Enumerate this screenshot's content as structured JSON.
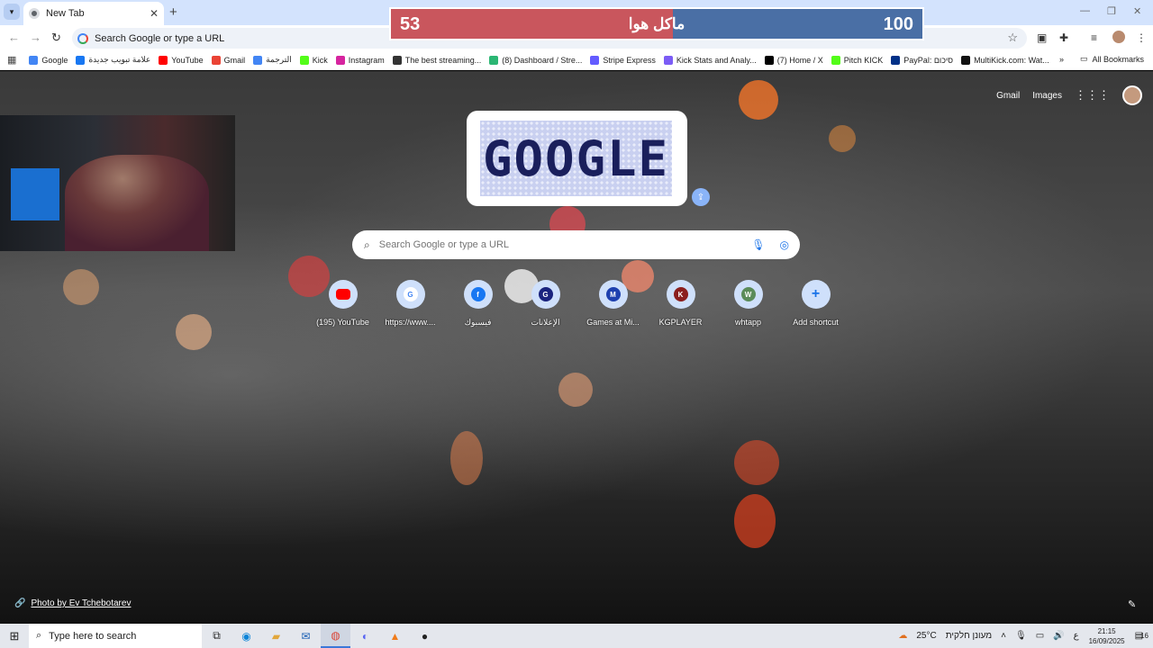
{
  "browser": {
    "tab_title": "New Tab",
    "omnibox_text": "Search Google or type a URL",
    "bookmarks": [
      {
        "label": "Google",
        "color": "#4285f4"
      },
      {
        "label": "علامة تبويب جديدة",
        "color": "#1877f2"
      },
      {
        "label": "YouTube",
        "color": "#ff0000"
      },
      {
        "label": "Gmail",
        "color": "#ea4335"
      },
      {
        "label": "الترجمة",
        "color": "#4285f4"
      },
      {
        "label": "Kick",
        "color": "#53fc18"
      },
      {
        "label": "Instagram",
        "color": "#d6249f"
      },
      {
        "label": "The best streaming...",
        "color": "#333333"
      },
      {
        "label": "(8) Dashboard / Stre...",
        "color": "#2bb673"
      },
      {
        "label": "Stripe Express",
        "color": "#635bff"
      },
      {
        "label": "Kick Stats and Analy...",
        "color": "#7b5cf5"
      },
      {
        "label": "(7) Home / X",
        "color": "#000000"
      },
      {
        "label": "Pitch KICK",
        "color": "#53fc18"
      },
      {
        "label": "PayPal: סיכום",
        "color": "#003087"
      },
      {
        "label": "MultiKick.com: Wat...",
        "color": "#111111"
      }
    ],
    "all_bookmarks_label": "All Bookmarks"
  },
  "ntp": {
    "gmail_link": "Gmail",
    "images_link": "Images",
    "doodle_text": "GOOGLE",
    "search_placeholder": "Search Google or type a URL",
    "shortcuts": [
      {
        "label": "(195) YouTube",
        "initial": "",
        "color": "#ff0000",
        "icon": "youtube-icon"
      },
      {
        "label": "https://www....",
        "initial": "G",
        "color": "#4285f4",
        "icon": "google-icon"
      },
      {
        "label": "فيسبوك",
        "initial": "f",
        "color": "#1877f2",
        "icon": "facebook-icon"
      },
      {
        "label": "الإعلانات",
        "initial": "G",
        "color": "#1a237e",
        "icon": "ads-icon"
      },
      {
        "label": "Games at Mi...",
        "initial": "M",
        "color": "#1e40af",
        "icon": "games-icon"
      },
      {
        "label": "KGPLAYER",
        "initial": "K",
        "color": "#8b1e1e",
        "icon": "kgplayer-icon"
      },
      {
        "label": "whtapp",
        "initial": "W",
        "color": "#5b8c5a",
        "icon": "whatsapp-icon"
      },
      {
        "label": "Add shortcut",
        "initial": "+",
        "color": "#cfe0fb",
        "icon": "plus-icon"
      }
    ],
    "photo_credit": "Photo by Ev Tchebotarev"
  },
  "overlay": {
    "left_value": "53",
    "right_value": "100",
    "label": "ماكل هوا",
    "progress_fraction": 0.53,
    "left_color": "#c9565d",
    "right_color": "#4a6fa5"
  },
  "taskbar": {
    "search_placeholder": "Type here to search",
    "weather": "25°C",
    "weather_text": "מעונן חלקית",
    "language": "ع",
    "time": "21:15",
    "date": "16/09/2025",
    "notifications": "16"
  }
}
